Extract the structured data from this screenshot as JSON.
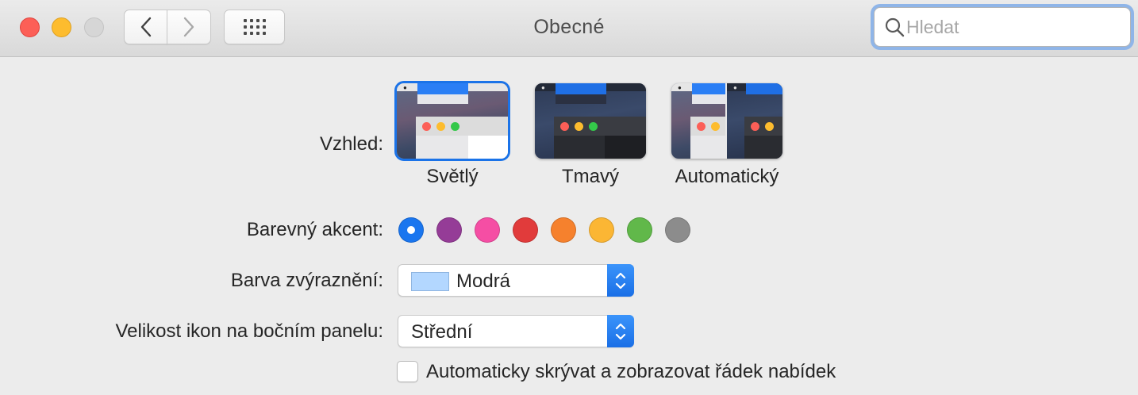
{
  "window": {
    "title": "Obecné",
    "search_placeholder": "Hledat"
  },
  "appearance": {
    "label": "Vzhled:",
    "options": [
      {
        "label": "Světlý",
        "selected": true
      },
      {
        "label": "Tmavý",
        "selected": false
      },
      {
        "label": "Automatický",
        "selected": false
      }
    ]
  },
  "accent": {
    "label": "Barevný akcent:",
    "colors": [
      "#1a76ef",
      "#953c97",
      "#f54ea4",
      "#e13b3b",
      "#f6812d",
      "#fbb634",
      "#61b84a",
      "#8c8c8c"
    ],
    "selected_index": 0
  },
  "highlight": {
    "label": "Barva zvýraznění:",
    "value": "Modrá",
    "swatch_color": "#b3d7ff"
  },
  "sidebar_icon_size": {
    "label": "Velikost ikon na bočním panelu:",
    "value": "Střední"
  },
  "menubar_autohide": {
    "label": "Automaticky skrývat a zobrazovat řádek nabídek",
    "checked": false
  }
}
